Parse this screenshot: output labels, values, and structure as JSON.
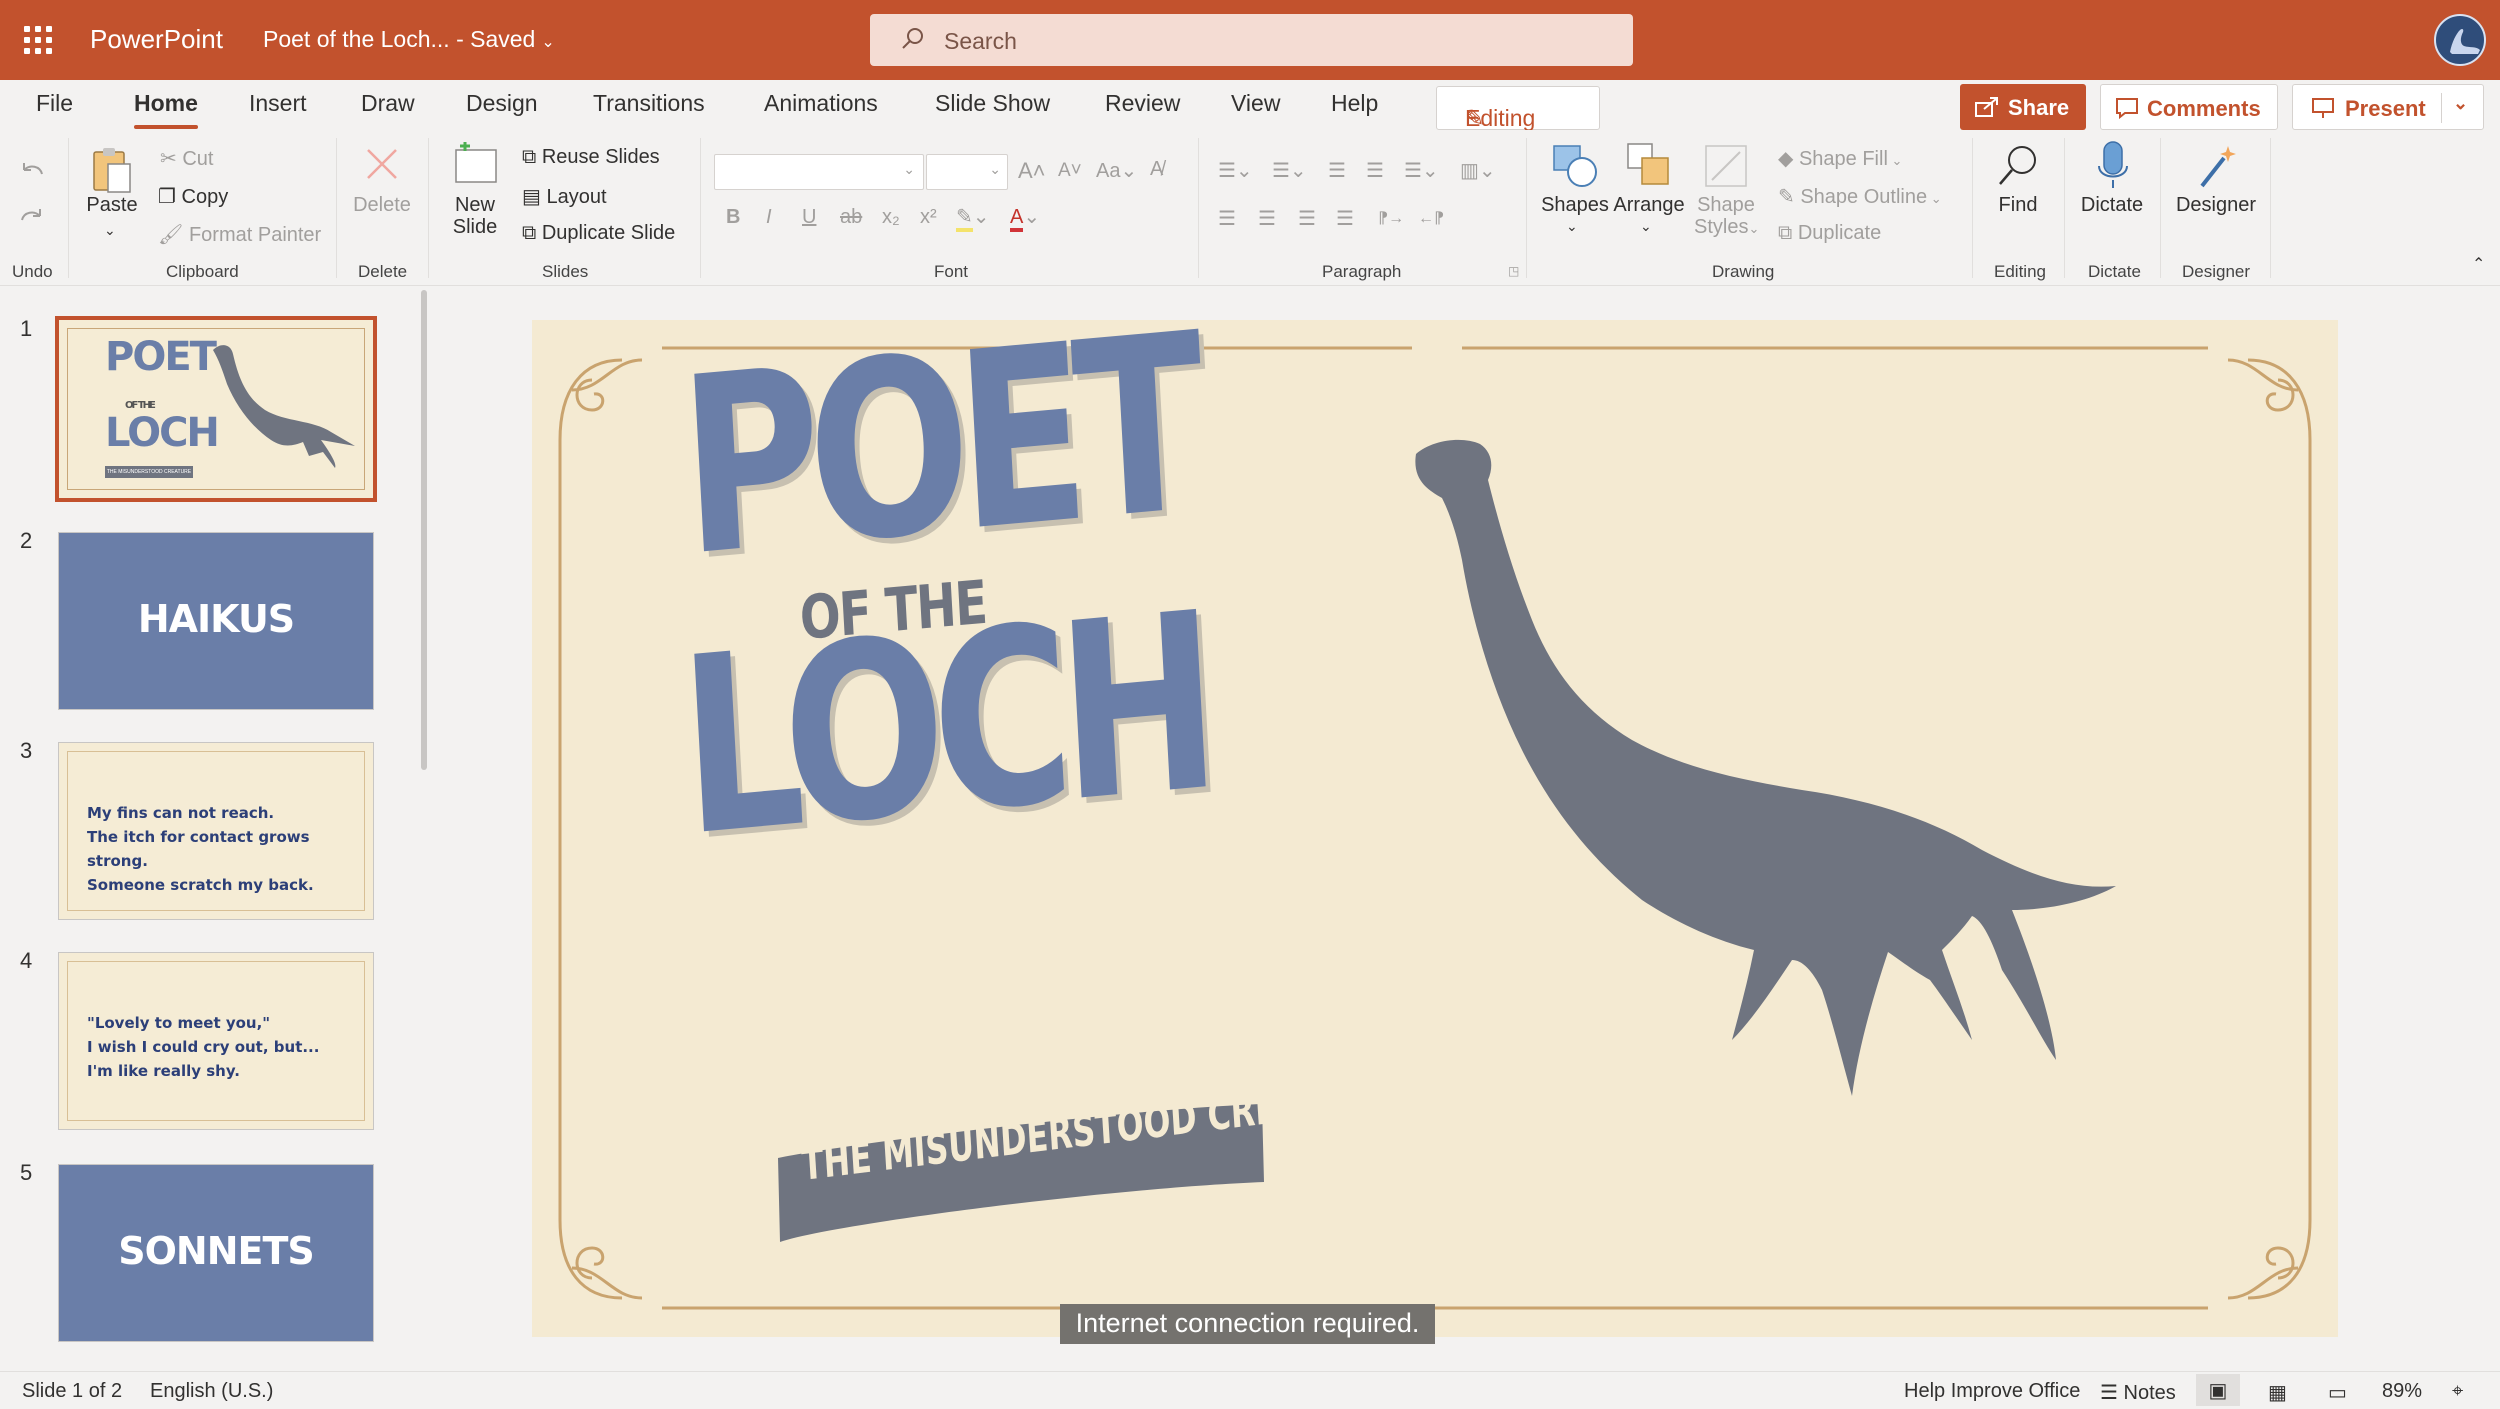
{
  "titlebar": {
    "app_name": "PowerPoint",
    "doc_title": "Poet of the Loch... - Saved",
    "search_placeholder": "Search",
    "accent": "#c2522d"
  },
  "menu": {
    "tabs": [
      "File",
      "Home",
      "Insert",
      "Draw",
      "Design",
      "Transitions",
      "Animations",
      "Slide Show",
      "Review",
      "View",
      "Help"
    ],
    "active_tab": "Home",
    "editing_label": "Editing",
    "share_label": "Share",
    "comments_label": "Comments",
    "present_label": "Present"
  },
  "ribbon": {
    "groups": {
      "undo": "Undo",
      "clipboard": "Clipboard",
      "delete": "Delete",
      "slides": "Slides",
      "font": "Font",
      "paragraph": "Paragraph",
      "drawing": "Drawing",
      "editing": "Editing",
      "dictate": "Dictate",
      "designer": "Designer"
    },
    "paste": "Paste",
    "cut": "Cut",
    "copy": "Copy",
    "format_painter": "Format Painter",
    "delete": "Delete",
    "new_slide_1": "New",
    "new_slide_2": "Slide",
    "reuse_slides": "Reuse Slides",
    "layout": "Layout",
    "duplicate_slide": "Duplicate Slide",
    "shapes": "Shapes",
    "arrange": "Arrange",
    "shape_styles_1": "Shape",
    "shape_styles_2": "Styles",
    "shape_fill": "Shape Fill",
    "shape_outline": "Shape Outline",
    "duplicate": "Duplicate",
    "find": "Find",
    "dictate": "Dictate",
    "designer": "Designer"
  },
  "thumbnails": [
    {
      "num": "1",
      "title_lines": [
        "POET",
        "OF THE",
        "LOCH"
      ],
      "subtitle": "THE MISUNDERSTOOD CREATURE",
      "style": "cover"
    },
    {
      "num": "2",
      "title": "HAIKUS",
      "style": "blue"
    },
    {
      "num": "3",
      "lines": [
        "My fins can not reach.",
        "The itch for contact grows strong.",
        "Someone scratch my back."
      ],
      "style": "cream"
    },
    {
      "num": "4",
      "lines": [
        "\"Lovely to meet you,\"",
        "I wish I could cry out, but...",
        "I'm like really shy."
      ],
      "style": "cream"
    },
    {
      "num": "5",
      "title": "SONNETS",
      "style": "blue"
    }
  ],
  "slide": {
    "title_line1": "POET",
    "title_line2": "OF THE",
    "title_line3": "LOCH",
    "subtitle": "THE MISUNDERSTOOD CREATURE",
    "title_color": "#6a7ea8",
    "creature_color": "#6f7480"
  },
  "toast": "Internet connection required.",
  "statusbar": {
    "slide_info": "Slide 1 of 2",
    "language": "English (U.S.)",
    "help_improve": "Help Improve Office",
    "notes": "Notes",
    "zoom": "89%"
  }
}
